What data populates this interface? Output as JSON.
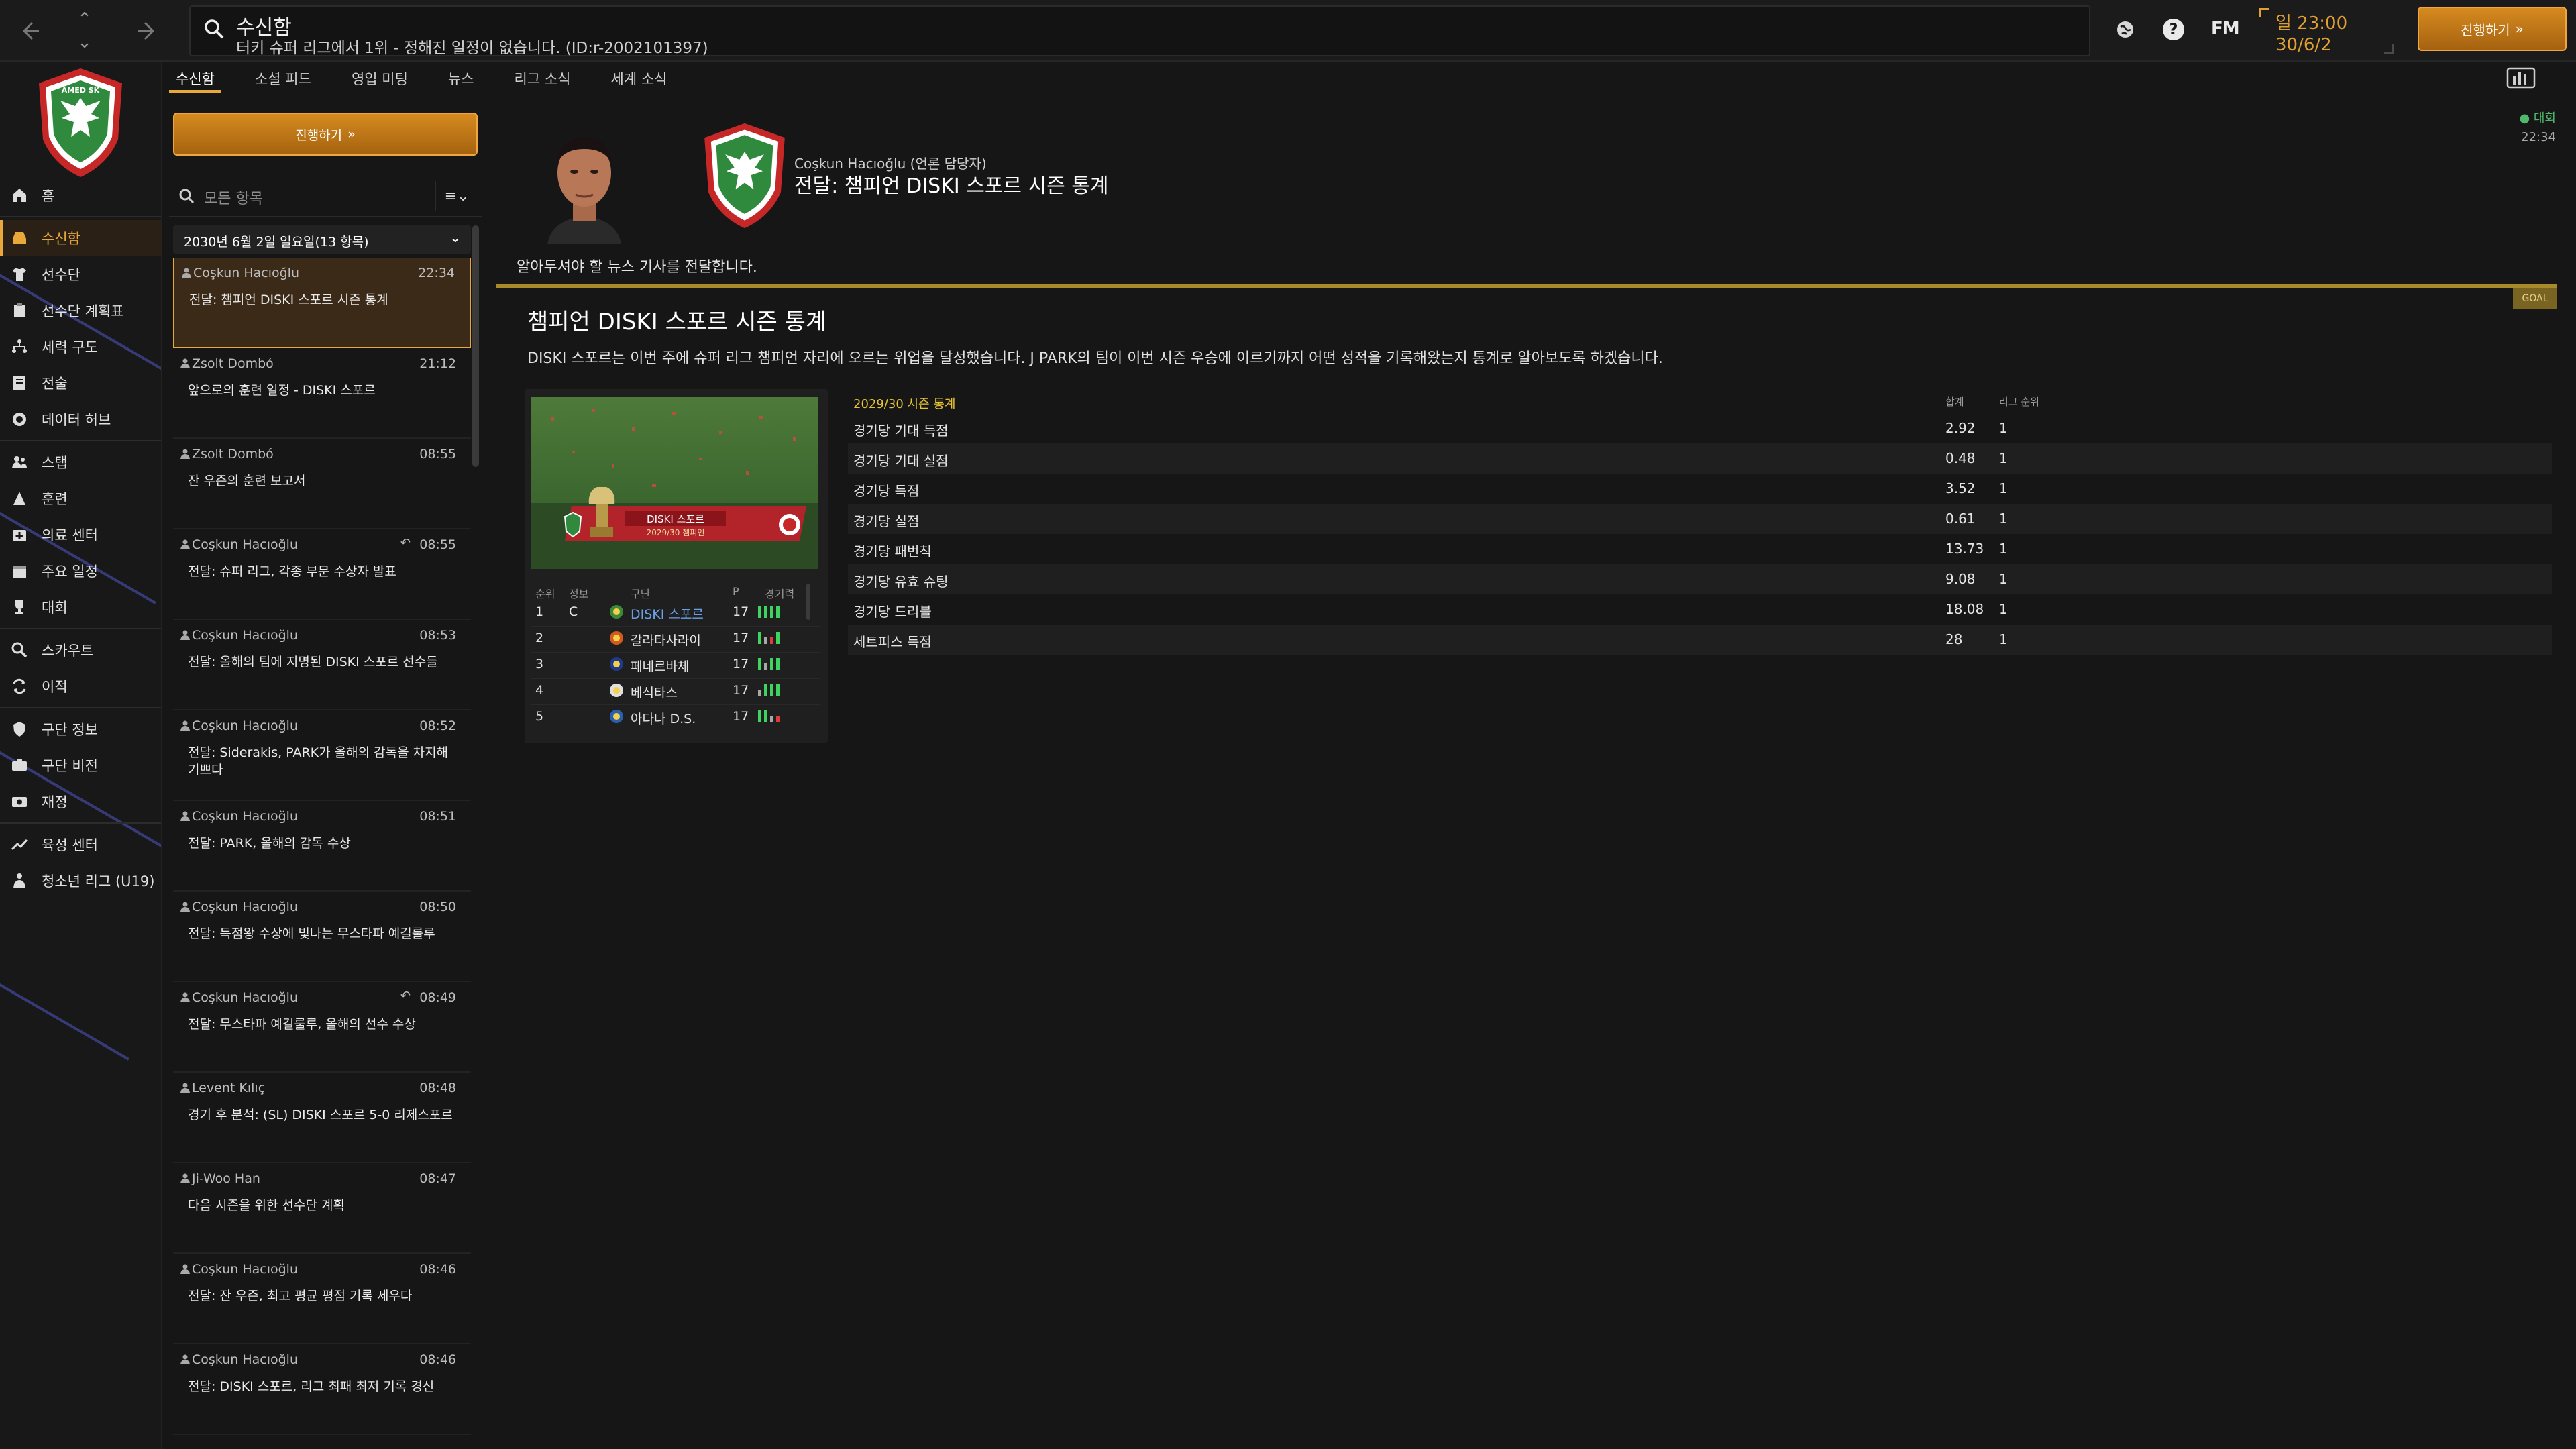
{
  "topbar": {
    "title": "수신함",
    "subtitle": "터키 슈퍼 리그에서 1위 - 정해진 일정이 없습니다. (ID:r-2002101397)",
    "fm_logo": "FM",
    "time": "일 23:00",
    "date": "30/6/2",
    "continue_label": "진행하기",
    "continue_arrow": "»"
  },
  "sidebar": {
    "items": [
      {
        "label": "홈",
        "icon": "home-icon"
      },
      {
        "label": "수신함",
        "icon": "inbox-icon",
        "active": true
      },
      {
        "label": "선수단",
        "icon": "shirt-icon"
      },
      {
        "label": "선수단 계획표",
        "icon": "clipboard-icon"
      },
      {
        "label": "세력 구도",
        "icon": "hierarchy-icon"
      },
      {
        "label": "전술",
        "icon": "tactics-icon"
      },
      {
        "label": "데이터 허브",
        "icon": "data-hub-icon"
      },
      {
        "label": "스탭",
        "icon": "staff-icon"
      },
      {
        "label": "훈련",
        "icon": "training-icon"
      },
      {
        "label": "의료 센터",
        "icon": "medical-icon"
      },
      {
        "label": "주요 일정",
        "icon": "calendar-icon"
      },
      {
        "label": "대회",
        "icon": "trophy-icon"
      },
      {
        "label": "스카우트",
        "icon": "scout-icon"
      },
      {
        "label": "이적",
        "icon": "transfer-icon"
      },
      {
        "label": "구단 정보",
        "icon": "club-info-icon"
      },
      {
        "label": "구단 비전",
        "icon": "vision-icon"
      },
      {
        "label": "재정",
        "icon": "finance-icon"
      },
      {
        "label": "육성 센터",
        "icon": "development-icon"
      },
      {
        "label": "청소년 리그 (U19)",
        "icon": "youth-icon"
      }
    ]
  },
  "subtabs": [
    "수신함",
    "소셜 피드",
    "영입 미팅",
    "뉴스",
    "리그 소식",
    "세계 소식"
  ],
  "inbox": {
    "continue_label": "진행하기",
    "continue_arrow": "»",
    "filter_placeholder": "모든 항목",
    "filter_menu": "≡",
    "group_header": "2030년 6월 2일 일요일(13 항목)",
    "messages": [
      {
        "sender": "Coşkun Hacıoğlu",
        "time": "22:34",
        "subject": "전달: 챔피언 DISKI 스포르 시즌 통계"
      },
      {
        "sender": "Zsolt Dombó",
        "time": "21:12",
        "subject": "앞으로의 훈련 일정 - DISKI 스포르"
      },
      {
        "sender": "Zsolt Dombó",
        "time": "08:55",
        "subject": "잔 우즌의 훈련 보고서"
      },
      {
        "sender": "Coşkun Hacıoğlu",
        "time": "08:55",
        "reply": "↶",
        "subject": "전달: 슈퍼 리그, 각종 부문 수상자 발표"
      },
      {
        "sender": "Coşkun Hacıoğlu",
        "time": "08:53",
        "subject": "전달: 올해의 팀에 지명된 DISKI 스포르 선수들"
      },
      {
        "sender": "Coşkun Hacıoğlu",
        "time": "08:52",
        "subject": "전달: Siderakis, PARK가 올해의 감독을 차지해 기쁘다"
      },
      {
        "sender": "Coşkun Hacıoğlu",
        "time": "08:51",
        "subject": "전달: PARK, 올해의 감독 수상"
      },
      {
        "sender": "Coşkun Hacıoğlu",
        "time": "08:50",
        "subject": "전달: 득점왕 수상에 빛나는 무스타파 예길룰루"
      },
      {
        "sender": "Coşkun Hacıoğlu",
        "time": "08:49",
        "reply": "↶",
        "subject": "전달: 무스타파 예길룰루, 올해의 선수 수상"
      },
      {
        "sender": "Levent Kılıç",
        "time": "08:48",
        "subject": "경기 후 분석: (SL) DISKI 스포르 5-0 리제스포르"
      },
      {
        "sender": "Ji-Woo Han",
        "time": "08:47",
        "subject": "다음 시즌을 위한 선수단 계획"
      },
      {
        "sender": "Coşkun Hacıoğlu",
        "time": "08:46",
        "subject": "전달: 잔 우즌, 최고 평균 평점 기록 세우다"
      },
      {
        "sender": "Coşkun Hacıoğlu",
        "time": "08:46",
        "subject": "전달: DISKI 스포르, 리그 최패 최저 기록 경신"
      }
    ]
  },
  "message": {
    "from": "Coşkun Hacıoğlu (언론 담당자)",
    "title": "전달: 챔피언 DISKI 스포르 시즌 통계",
    "competition_tag": "대회",
    "time": "22:34",
    "intro": "알아두셔야 할 뉴스 기사를 전달합니다.",
    "goal_tag": "GOAL",
    "news_title": "챔피언 DISKI 스포르 시즌 통계",
    "news_body": "DISKI 스포르는 이번 주에 슈퍼 리그 챔피언 자리에 오르는 위업을 달성했습니다. J PARK의 팀이 이번 시즌 우승에 이르기까지 어떤 성적을 기록해왔는지 통계로 알아보도록 하겠습니다.",
    "banner_club": "DISKI 스포르",
    "banner_sub": "2029/30 챔피언"
  },
  "mini_table": {
    "headers": [
      "순위",
      "정보",
      "구단",
      "P",
      "경기력"
    ],
    "rows": [
      {
        "pos": "1",
        "info": "C",
        "club": "DISKI 스포르",
        "p": "17",
        "form": [
          "w",
          "w",
          "w",
          "w"
        ]
      },
      {
        "pos": "2",
        "info": "",
        "club": "갈라타사라이",
        "p": "17",
        "form": [
          "w",
          "d",
          "l",
          "w"
        ]
      },
      {
        "pos": "3",
        "info": "",
        "club": "페네르바체",
        "p": "17",
        "form": [
          "w",
          "d",
          "w",
          "w"
        ]
      },
      {
        "pos": "4",
        "info": "",
        "club": "베식타스",
        "p": "17",
        "form": [
          "d",
          "w",
          "w",
          "w"
        ]
      },
      {
        "pos": "5",
        "info": "",
        "club": "아다나 D.S.",
        "p": "17",
        "form": [
          "w",
          "w",
          "d",
          "l"
        ]
      }
    ]
  },
  "stats": {
    "title": "2029/30 시즌 통계",
    "col_value": "합계",
    "col_rank": "리그 순위",
    "rows": [
      {
        "name": "경기당 기대 득점",
        "value": "2.92",
        "rank": "1"
      },
      {
        "name": "경기당 기대 실점",
        "value": "0.48",
        "rank": "1"
      },
      {
        "name": "경기당 득점",
        "value": "3.52",
        "rank": "1"
      },
      {
        "name": "경기당 실점",
        "value": "0.61",
        "rank": "1"
      },
      {
        "name": "경기당 패번칙",
        "value": "13.73",
        "rank": "1"
      },
      {
        "name": "경기당 유효 슈팅",
        "value": "9.08",
        "rank": "1"
      },
      {
        "name": "경기당 드리블",
        "value": "18.08",
        "rank": "1"
      },
      {
        "name": "세트피스 득점",
        "value": "28",
        "rank": "1"
      }
    ]
  },
  "colors": {
    "accent": "#e8a83a",
    "badge_green": "#2f8a3e",
    "badge_red": "#c62828",
    "form_win": "#3fd45f"
  }
}
